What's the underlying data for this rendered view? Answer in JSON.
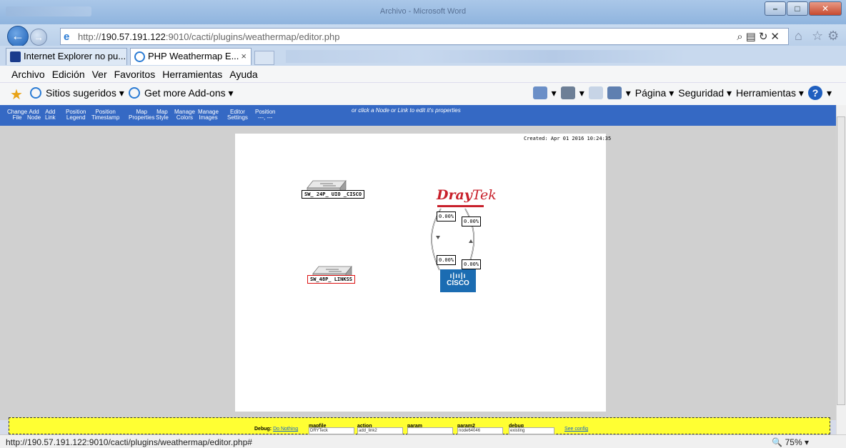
{
  "window": {
    "title": "Archivo - Microsoft Word"
  },
  "address": {
    "url_prefix": "http://",
    "url_host": "190.57.191.122",
    "url_rest": ":9010/cacti/plugins/weathermap/editor.php"
  },
  "tabs": [
    {
      "label": "Internet Explorer no pu..."
    },
    {
      "label": "PHP Weathermap E...",
      "close": "×"
    }
  ],
  "menu": [
    "Archivo",
    "Edición",
    "Ver",
    "Favoritos",
    "Herramientas",
    "Ayuda"
  ],
  "favorites": {
    "sites": "Sitios sugeridos ▾",
    "addons": "Get more Add-ons ▾"
  },
  "command_bar": {
    "pagina": "Página ▾",
    "seguridad": "Seguridad ▾",
    "herramientas": "Herramientas ▾",
    "help": "?"
  },
  "editor_toolbar": {
    "buttons": [
      [
        "Change",
        "File"
      ],
      [
        "Add",
        "Node"
      ],
      [
        "Add",
        "Link"
      ],
      [
        "Position",
        "Legend"
      ],
      [
        "Position",
        "Timestamp"
      ],
      [
        "Map",
        "Properties"
      ],
      [
        "Map",
        "Style"
      ],
      [
        "Manage",
        "Colors"
      ],
      [
        "Manage",
        "Images"
      ],
      [
        "Editor",
        "Settings"
      ],
      [
        "Position",
        "---, ---"
      ]
    ],
    "hint": "or click a Node or Link to edit it's properties"
  },
  "map": {
    "created": "Created: Apr 01 2016 10:24:35",
    "nodes": [
      {
        "label": "SW_ 24P_ UIO _CISCO"
      },
      {
        "label": "SW_48P_ LINKSS"
      }
    ],
    "draytek": {
      "dray": "Dray",
      "tek": "Tek"
    },
    "cisco": {
      "bars": "ı|ıı|ı",
      "text": "CISCO"
    },
    "links": [
      "0.00%",
      "0.00%",
      "0.00%",
      "0.00%"
    ]
  },
  "debug": {
    "label": "Debug:",
    "do_nothing": "Do Nothing",
    "mapfile_label": "mapfile",
    "mapfile_value": "DRYTeck",
    "action_label": "action",
    "action_value": "add_link2",
    "param_label": "param",
    "param_value": "",
    "param2_label": "param2",
    "param2_value": "node64046",
    "debug_label": "debug",
    "debug_value": "existing",
    "see_config": "See config"
  },
  "status": {
    "url": "http://190.57.191.122:9010/cacti/plugins/weathermap/editor.php#",
    "zoom": "75%"
  }
}
